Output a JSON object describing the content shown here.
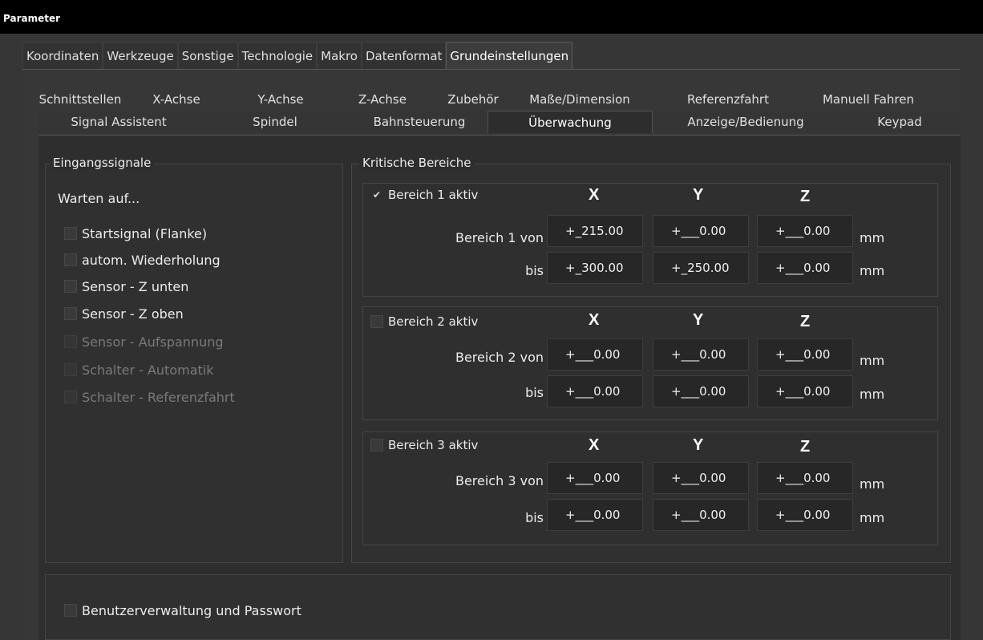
{
  "window": {
    "title": "Parameter"
  },
  "main_tabs": [
    "Koordinaten",
    "Werkzeuge",
    "Sonstige",
    "Technologie",
    "Makro",
    "Datenformat",
    "Grundeinstellungen"
  ],
  "sub_tabs_row1": [
    "Schnittstellen",
    "X-Achse",
    "Y-Achse",
    "Z-Achse",
    "Zubehör",
    "Maße/Dimension",
    "Referenzfahrt",
    "Manuell Fahren"
  ],
  "sub_tabs_row2": [
    "Signal Assistent",
    "Spindel",
    "Bahnsteuerung",
    "Überwachung",
    "Anzeige/Bedienung",
    "Keypad"
  ],
  "eingangssignale": {
    "title": "Eingangssignale",
    "warten_auf": "Warten auf...",
    "items": [
      {
        "label": "Startsignal (Flanke)",
        "checked": false,
        "enabled": true
      },
      {
        "label": "autom. Wiederholung",
        "checked": false,
        "enabled": true
      },
      {
        "label": "Sensor - Z unten",
        "checked": false,
        "enabled": true
      },
      {
        "label": "Sensor - Z oben",
        "checked": false,
        "enabled": true
      },
      {
        "label": "Sensor - Aufspannung",
        "checked": false,
        "enabled": false
      },
      {
        "label": "Schalter - Automatik",
        "checked": false,
        "enabled": false
      },
      {
        "label": "Schalter - Referenzfahrt",
        "checked": false,
        "enabled": false
      }
    ]
  },
  "kritische_bereiche": {
    "title": "Kritische Bereiche",
    "axis_x": "X",
    "axis_y": "Y",
    "axis_z": "Z",
    "unit": "mm",
    "bis_label": "bis",
    "bereich1": {
      "aktiv_label": "Bereich 1 aktiv",
      "checked": true,
      "von_label": "Bereich 1 von",
      "von": {
        "x": "+_215.00",
        "y": "+___0.00",
        "z": "+___0.00"
      },
      "bis": {
        "x": "+_300.00",
        "y": "+_250.00",
        "z": "+___0.00"
      }
    },
    "bereich2": {
      "aktiv_label": "Bereich 2 aktiv",
      "checked": false,
      "von_label": "Bereich 2 von",
      "von": {
        "x": "+___0.00",
        "y": "+___0.00",
        "z": "+___0.00"
      },
      "bis": {
        "x": "+___0.00",
        "y": "+___0.00",
        "z": "+___0.00"
      }
    },
    "bereich3": {
      "aktiv_label": "Bereich 3 aktiv",
      "checked": false,
      "von_label": "Bereich 3 von",
      "von": {
        "x": "+___0.00",
        "y": "+___0.00",
        "z": "+___0.00"
      },
      "bis": {
        "x": "+___0.00",
        "y": "+___0.00",
        "z": "+___0.00"
      }
    }
  },
  "benutzerverwaltung": {
    "label": "Benutzerverwaltung und Passwort",
    "checked": false
  }
}
